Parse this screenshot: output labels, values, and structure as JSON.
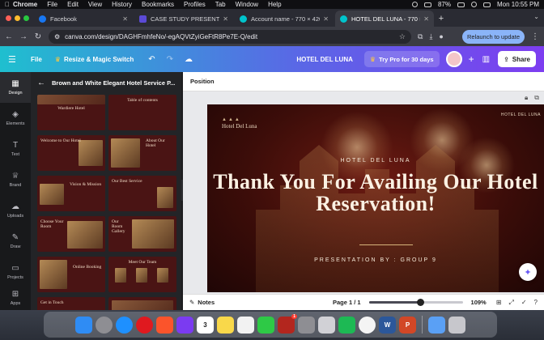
{
  "menubar": {
    "app_name": "Chrome",
    "items": [
      "File",
      "Edit",
      "View",
      "History",
      "Bookmarks",
      "Profiles",
      "Tab",
      "Window",
      "Help"
    ],
    "battery": "87%",
    "clock": "Mon 10:55 PM"
  },
  "tabs": [
    {
      "title": "Facebook",
      "color": "#1877f2"
    },
    {
      "title": "CASE STUDY PRESENTATION",
      "color": "#5b4ad6"
    },
    {
      "title": "Account name - 770 × 420px",
      "color": "#00c4cc"
    },
    {
      "title": "HOTEL DEL LUNA - 770 × 420",
      "color": "#00c4cc"
    }
  ],
  "address": {
    "url": "canva.com/design/DAGHFmhfeNo/-egAQVtZyiGeFtR8Pe7E-Q/edit",
    "relaunch_label": "Relaunch to update"
  },
  "canva_header": {
    "file_label": "File",
    "resize_label": "Resize & Magic Switch",
    "doc_title": "HOTEL DEL LUNA",
    "try_pro_label": "Try Pro for 30 days",
    "share_label": "Share"
  },
  "rail": [
    {
      "label": "Design",
      "icon": "design-icon",
      "active": true
    },
    {
      "label": "Elements",
      "icon": "elements-icon",
      "active": false
    },
    {
      "label": "Text",
      "icon": "text-icon",
      "active": false
    },
    {
      "label": "Brand",
      "icon": "brand-icon",
      "active": false
    },
    {
      "label": "Uploads",
      "icon": "uploads-icon",
      "active": false
    },
    {
      "label": "Draw",
      "icon": "draw-icon",
      "active": false
    },
    {
      "label": "Projects",
      "icon": "projects-icon",
      "active": false
    },
    {
      "label": "Apps",
      "icon": "apps-icon",
      "active": false
    }
  ],
  "panel": {
    "title": "Brown and White Elegant Hotel Service P...",
    "thumbs": [
      "Wardiere Hotel",
      "Table of contents",
      "Welcome to Our Hotel",
      "About Our Hotel",
      "Vision & Mission",
      "Our Best Service",
      "Choose Your Room",
      "Our Room Gallery",
      "Online Booking",
      "Meet Our Team",
      "Get in Touch",
      ""
    ]
  },
  "workspace": {
    "context_label": "Position",
    "slide": {
      "logo_text": "Hotel Del Luna",
      "top_right": "HOTEL DEL LUNA",
      "eyebrow": "HOTEL DEL LUNA",
      "heading": "Thank You For Availing Our Hotel Reservation!",
      "footer": "PRESENTATION BY : GROUP 9"
    }
  },
  "statusbar": {
    "notes_label": "Notes",
    "page_label": "Page 1 / 1",
    "zoom_label": "109%",
    "zoom_fraction": 0.55
  },
  "dock": [
    {
      "name": "finder",
      "color": "#2f8cf4"
    },
    {
      "name": "launchpad",
      "color": "#8e8e93"
    },
    {
      "name": "safari",
      "color": "#1e90ff"
    },
    {
      "name": "opera",
      "color": "#e0191f"
    },
    {
      "name": "brave",
      "color": "#fb542b"
    },
    {
      "name": "messenger",
      "color": "#7b3bf1"
    },
    {
      "name": "calendar",
      "color": "#ffffff"
    },
    {
      "name": "notes",
      "color": "#f9d84a"
    },
    {
      "name": "photos",
      "color": "#f2f2f2"
    },
    {
      "name": "facetime",
      "color": "#2ec946"
    },
    {
      "name": "photo-booth",
      "color": "#b3261e"
    },
    {
      "name": "system-settings",
      "color": "#8e8e93"
    },
    {
      "name": "preview",
      "color": "#d1d1d6"
    },
    {
      "name": "spotify",
      "color": "#1db954"
    },
    {
      "name": "chrome",
      "color": "#f4f4f4"
    },
    {
      "name": "word",
      "color": "#2b579a"
    },
    {
      "name": "powerpoint",
      "color": "#d24726"
    },
    {
      "name": "downloads",
      "color": "#5aa0f5"
    },
    {
      "name": "trash",
      "color": "#c7c7cc"
    }
  ],
  "dock_labels": {
    "calendar_date": "3",
    "word": "W",
    "powerpoint": "P",
    "photo_booth_badge": "1"
  }
}
